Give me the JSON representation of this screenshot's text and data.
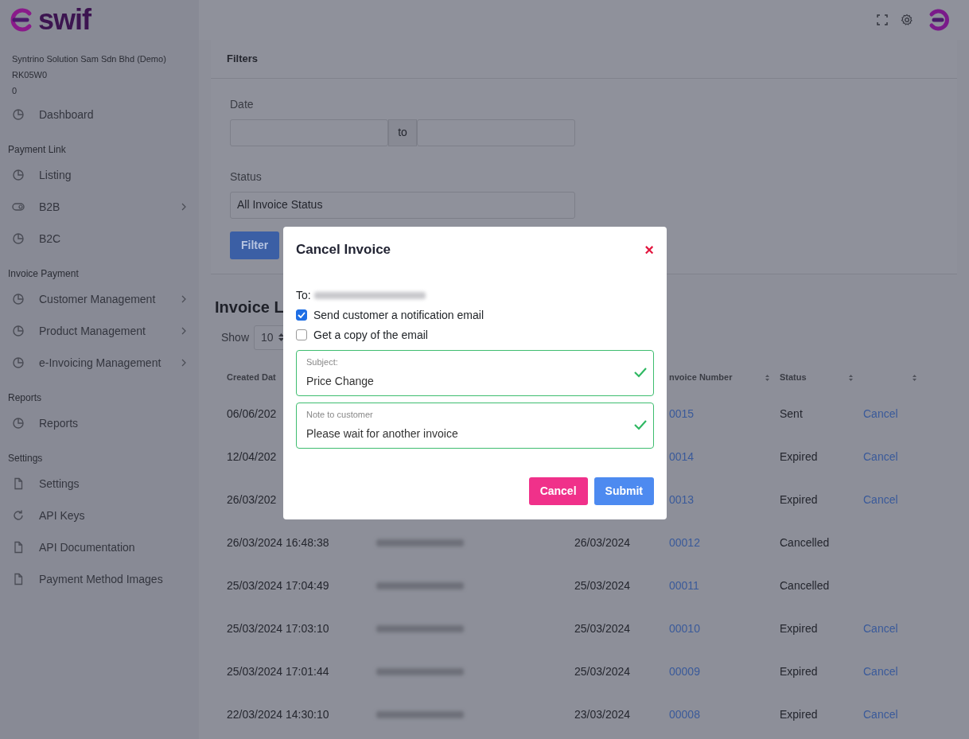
{
  "brand": {
    "logo_text": "swif"
  },
  "sidebar": {
    "company": "Syntrino Solution Sam Sdn Bhd (Demo)",
    "code": "RK05W0",
    "balance": "0",
    "sections": [
      {
        "items": [
          {
            "label": "Dashboard",
            "kind": "chart",
            "submenu": false
          }
        ]
      },
      {
        "heading": "Payment Link",
        "items": [
          {
            "label": "Listing",
            "kind": "chart",
            "submenu": false
          },
          {
            "label": "B2B",
            "kind": "toggle",
            "submenu": true
          },
          {
            "label": "B2C",
            "kind": "chart",
            "submenu": false
          }
        ]
      },
      {
        "heading": "Invoice Payment",
        "items": [
          {
            "label": "Customer Management",
            "kind": "chart",
            "submenu": true
          },
          {
            "label": "Product Management",
            "kind": "chart",
            "submenu": true
          },
          {
            "label": "e-Invoicing Management",
            "kind": "chart",
            "submenu": true
          }
        ]
      },
      {
        "heading": "Reports",
        "items": [
          {
            "label": "Reports",
            "kind": "chart",
            "submenu": false
          }
        ]
      },
      {
        "heading": "Settings",
        "items": [
          {
            "label": "Settings",
            "kind": "page",
            "submenu": false
          },
          {
            "label": "API Keys",
            "kind": "reload",
            "submenu": false
          },
          {
            "label": "API Documentation",
            "kind": "page",
            "submenu": false
          },
          {
            "label": "Payment Method Images",
            "kind": "page",
            "submenu": false
          }
        ]
      }
    ]
  },
  "filters": {
    "title": "Filters",
    "date_label": "Date",
    "date_separator": "to",
    "status_label": "Status",
    "status_value": "All Invoice Status",
    "button": "Filter"
  },
  "invoice_list": {
    "title": "Invoice L",
    "show_label": "Show",
    "page_size": "10",
    "header": {
      "created": "Created Dat",
      "invoice": "nvoice Number",
      "status": "Status"
    },
    "rows": [
      {
        "created": "06/06/202",
        "invoice": "0015",
        "status": "Sent",
        "action": "Cancel"
      },
      {
        "created": "12/04/202",
        "invoice": "0014",
        "status": "Expired",
        "action": "Cancel"
      },
      {
        "created": "26/03/202",
        "invoice": "0013",
        "status": "Expired",
        "action": "Cancel"
      },
      {
        "created": "26/03/2024 16:48:38",
        "email_blurred": true,
        "due_date": "26/03/2024",
        "invoice": "00012",
        "status": "Cancelled"
      },
      {
        "created": "25/03/2024 17:04:49",
        "email_blurred": true,
        "due_date": "25/03/2024",
        "invoice": "00011",
        "status": "Cancelled"
      },
      {
        "created": "25/03/2024 17:03:10",
        "email_blurred": true,
        "due_date": "25/03/2024",
        "invoice": "00010",
        "status": "Expired",
        "action": "Cancel"
      },
      {
        "created": "25/03/2024 17:01:44",
        "email_blurred": true,
        "due_date": "25/03/2024",
        "invoice": "00009",
        "status": "Expired",
        "action": "Cancel"
      },
      {
        "created": "22/03/2024 14:30:10",
        "email_blurred": true,
        "due_date": "23/03/2024",
        "invoice": "00008",
        "status": "Expired",
        "action": "Cancel"
      }
    ]
  },
  "modal": {
    "title": "Cancel Invoice",
    "close": "×",
    "to_label": "To:",
    "checkboxes": [
      {
        "label": "Send customer a notification email",
        "checked": true
      },
      {
        "label": "Get a copy of the email",
        "checked": false
      }
    ],
    "subject": {
      "label": "Subject:",
      "value": "Price Change",
      "valid": true
    },
    "note": {
      "label": "Note to customer",
      "value": "Please wait for another invoice",
      "valid": true
    },
    "buttons": [
      {
        "label": "Cancel",
        "kind": "danger"
      },
      {
        "label": "Submit",
        "kind": "primary"
      }
    ]
  }
}
